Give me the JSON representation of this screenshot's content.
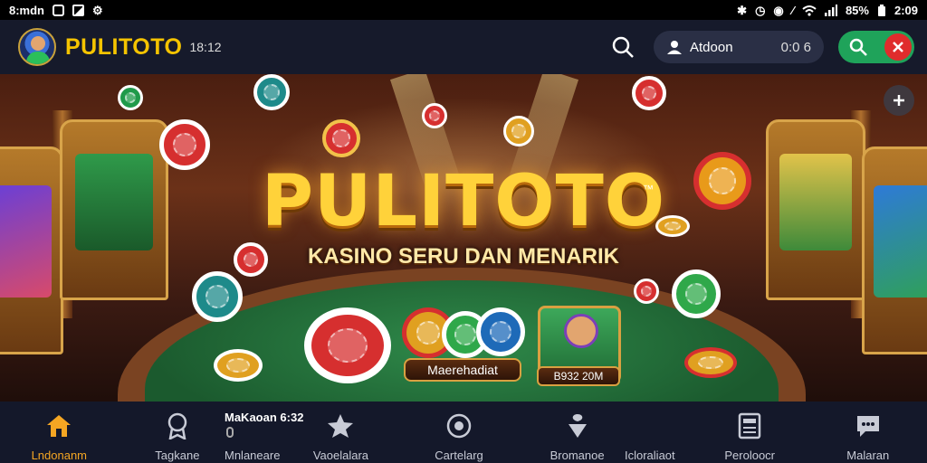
{
  "status_bar": {
    "left_text": "8:mdn",
    "battery": "85%",
    "time": "2:09"
  },
  "header": {
    "brand": "PULITOTO",
    "brand_sub": "18:12",
    "account_name": "Atdoon",
    "account_balance": "0:0 6"
  },
  "banner": {
    "title": "PULITOTO",
    "trademark": "™",
    "subtitle": "KASINO SERU DAN MENARIK",
    "plaque_label": "Maerehadiat",
    "card_label": "B932 20M"
  },
  "bottom_nav": {
    "items": [
      {
        "label": "Lndonanm",
        "icon": "home-icon",
        "active": true
      },
      {
        "label": "Tagkane",
        "icon": "medal-icon",
        "active": false
      },
      {
        "label": "Vaoelalara",
        "icon": "star-icon",
        "active": false
      },
      {
        "label": "Cartelarg",
        "icon": "support-icon",
        "active": false
      },
      {
        "label": "Bromanoe",
        "icon": "gift-icon",
        "active": false
      },
      {
        "label": "Peroloocr",
        "icon": "document-icon",
        "active": false
      },
      {
        "label": "Malaran",
        "icon": "chat-icon",
        "active": false
      }
    ],
    "overlay_top": "MaKaoan 6:32",
    "overlay_bottom": "Mnlaneare",
    "overlay_extra": "Icloraliaot"
  },
  "colors": {
    "brand_yellow": "#f5c400",
    "active_orange": "#f5a623",
    "action_green": "#1fa35a",
    "close_red": "#e02c2c"
  }
}
